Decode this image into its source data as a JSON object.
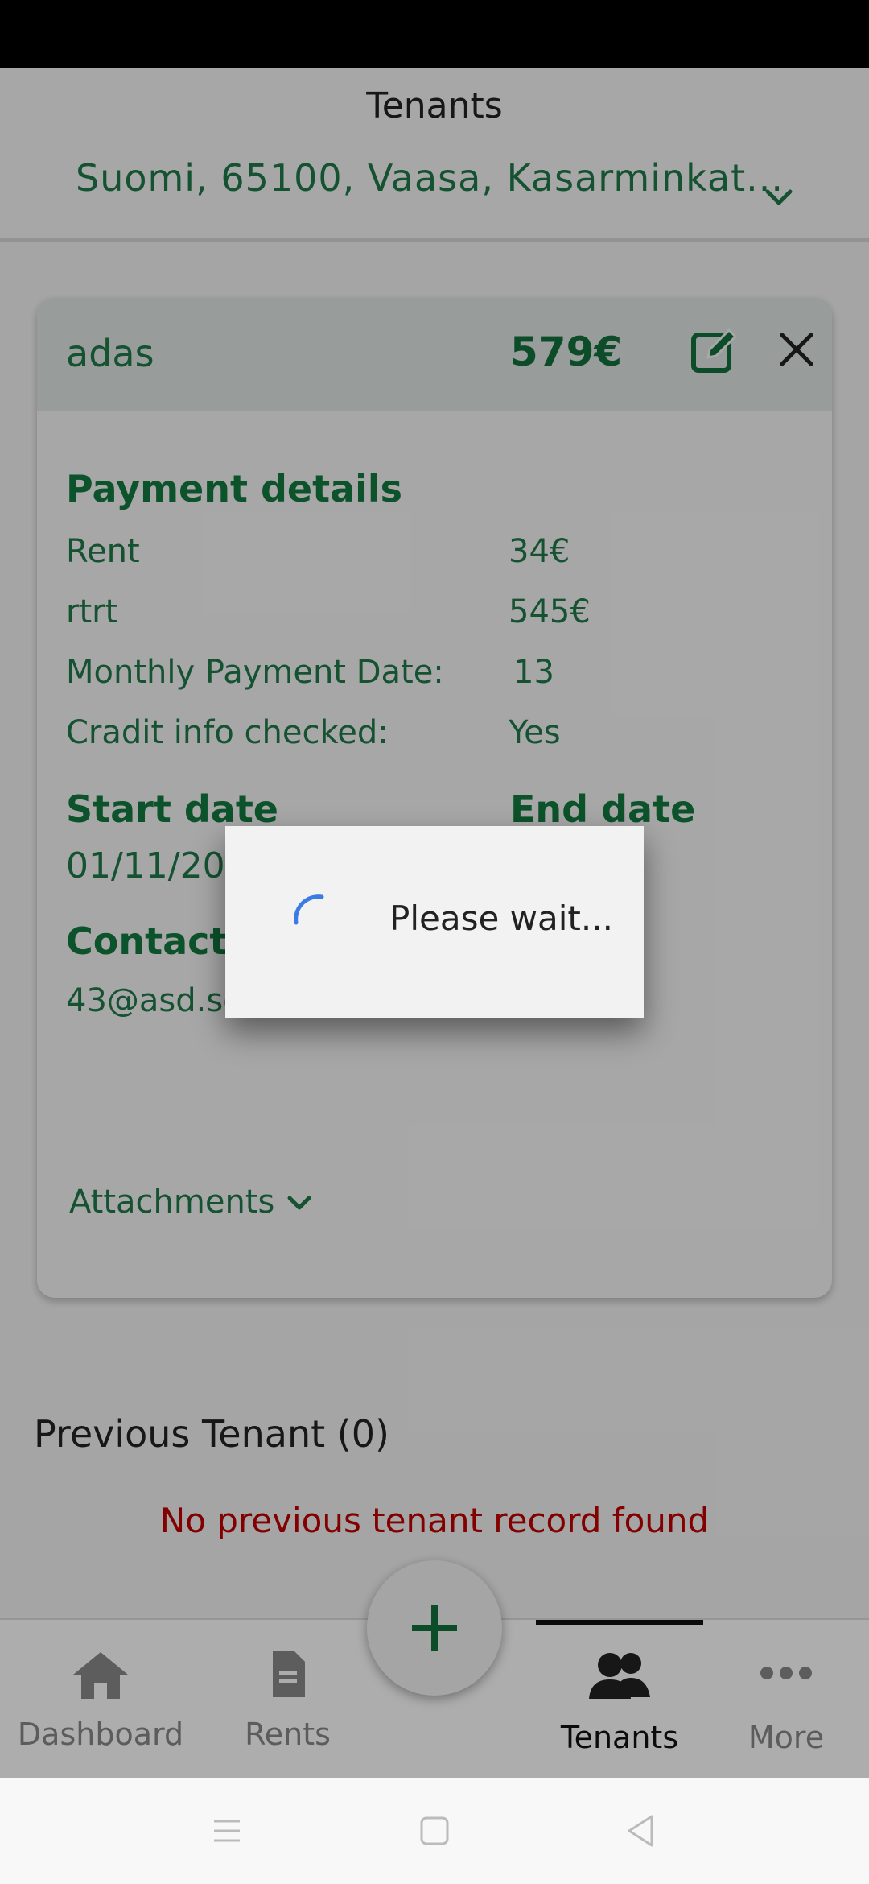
{
  "header": {
    "title": "Tenants",
    "address": "Suomi, 65100, Vaasa, Kasarminkat..."
  },
  "tenant_card": {
    "name": "adas",
    "total": "579€",
    "payment_details_title": "Payment details",
    "rows": [
      {
        "label": "Rent",
        "value": "34€"
      },
      {
        "label": "rtrt",
        "value": "545€"
      },
      {
        "label": "Monthly Payment Date:",
        "value": "13"
      },
      {
        "label": "Cradit info checked:",
        "value": "Yes"
      }
    ],
    "start_date_title": "Start date",
    "start_date_value": "01/11/20",
    "end_date_title": "End date",
    "contact_title": "Contact d",
    "contact_value": "43@asd.sd",
    "attachments_label": "Attachments"
  },
  "previous_tenant": {
    "title": "Previous Tenant (0)",
    "empty_message": "No previous tenant record found"
  },
  "bottom_nav": {
    "items": [
      {
        "label": "Dashboard",
        "icon": "home-icon"
      },
      {
        "label": "Rents",
        "icon": "document-icon"
      },
      {
        "label": "Tenants",
        "icon": "users-icon",
        "active": true
      },
      {
        "label": "More",
        "icon": "more-dots-icon"
      }
    ],
    "fab_icon": "plus-icon"
  },
  "dialog": {
    "message": "Please wait..."
  },
  "colors": {
    "brand_green": "#1f7a4a",
    "error_red": "#c00000",
    "spinner_blue": "#3b7be6"
  }
}
